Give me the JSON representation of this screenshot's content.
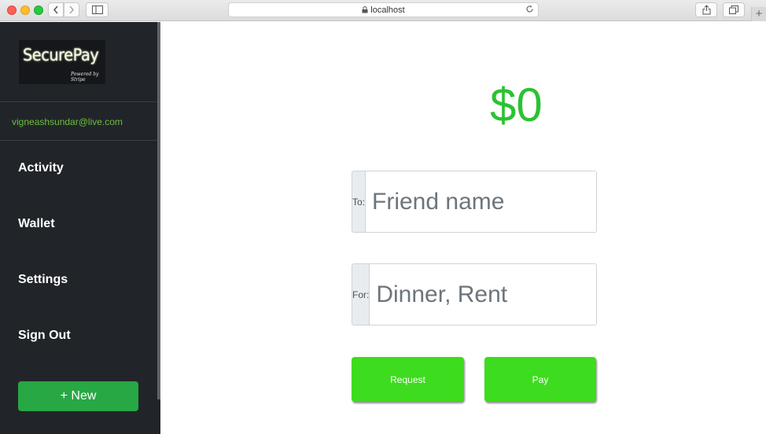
{
  "browser": {
    "url": "localhost",
    "icons": {
      "back": "chevron-left-icon",
      "forward": "chevron-right-icon",
      "sidebar": "sidebar-icon",
      "lock": "lock-icon",
      "reload": "reload-icon",
      "share": "share-icon",
      "tabs": "tabs-icon",
      "new_tab": "plus-icon"
    }
  },
  "sidebar": {
    "logo": {
      "title": "SecurePay",
      "subtitle": "Powered by Stripe"
    },
    "email": "vigneashsundar@live.com",
    "nav": [
      {
        "label": "Activity"
      },
      {
        "label": "Wallet"
      },
      {
        "label": "Settings"
      },
      {
        "label": "Sign Out"
      }
    ],
    "new_button": "+ New"
  },
  "main": {
    "amount": "$0",
    "to_field": {
      "prefix": "To:",
      "placeholder": "Friend name",
      "value": ""
    },
    "for_field": {
      "prefix": "For:",
      "placeholder": "Dinner, Rent",
      "value": ""
    },
    "request_button": "Request",
    "pay_button": "Pay"
  },
  "colors": {
    "sidebar_bg": "#212529",
    "email": "#6cbf3c",
    "new_button": "#28a745",
    "amount": "#2bc232",
    "action_buttons": "#3ddc1e"
  }
}
